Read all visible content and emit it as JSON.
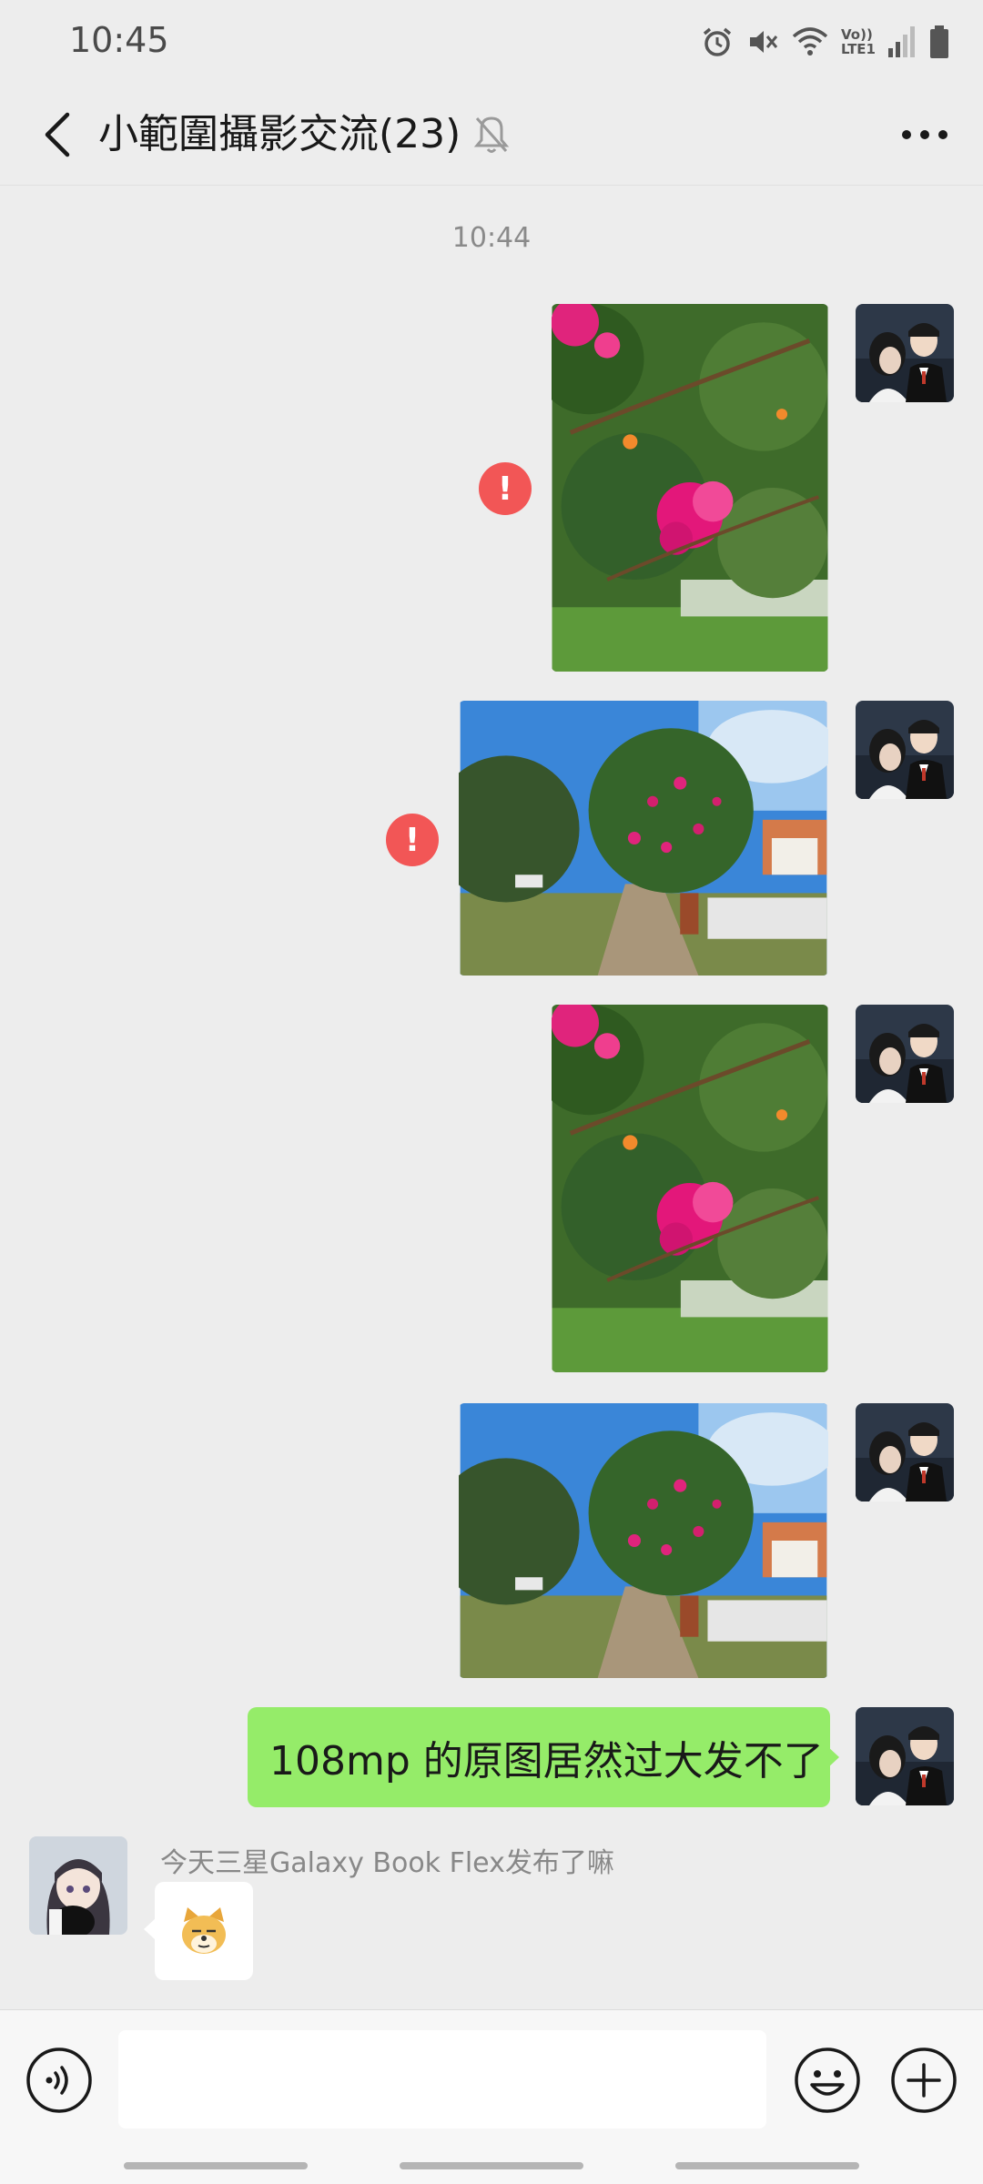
{
  "status_bar": {
    "time": "10:45",
    "icons": [
      "alarm-icon",
      "mute-icon",
      "wifi-icon",
      "volte-lte1-icon",
      "signal-icon",
      "battery-icon"
    ],
    "volte_text_top": "Vo))",
    "volte_text_bottom": "LTE1"
  },
  "header": {
    "title": "小範圍攝影交流(23)",
    "back_icon": "chevron-left-icon",
    "muted_icon": "bell-off-icon",
    "more_icon": "ellipsis-icon"
  },
  "chat": {
    "time_divider": "10:44",
    "messages": [
      {
        "type": "image",
        "from": "self",
        "subject": "pink bougainvillea close-up",
        "failed": true
      },
      {
        "type": "image",
        "from": "self",
        "subject": "street with bougainvillea tree",
        "failed": true
      },
      {
        "type": "image",
        "from": "self",
        "subject": "pink bougainvillea close-up",
        "failed": false
      },
      {
        "type": "image",
        "from": "self",
        "subject": "street with bougainvillea tree",
        "failed": false
      },
      {
        "type": "text",
        "from": "self",
        "text": "108mp 的原图居然过大发不了"
      },
      {
        "type": "sticker",
        "from": "other",
        "sender": "今天三星Galaxy Book Flex发布了嘛",
        "sticker_icon": "doge-face-icon"
      }
    ],
    "error_symbol": "!"
  },
  "input_bar": {
    "voice_icon": "voice-icon",
    "emoji_icon": "smiley-icon",
    "plus_icon": "plus-icon",
    "text_value": ""
  },
  "colors": {
    "background": "#ededed",
    "self_bubble": "#95ec69",
    "error": "#f25656",
    "input_bar": "#f7f7f7"
  }
}
